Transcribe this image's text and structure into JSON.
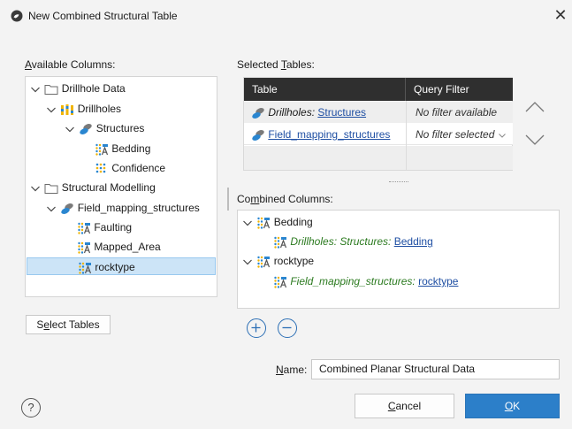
{
  "window": {
    "title": "New Combined Structural Table"
  },
  "available": {
    "label_u": "A",
    "label_rest": "vailable Columns:",
    "tree": [
      {
        "label": "Drillhole Data"
      },
      {
        "label": "Drillholes"
      },
      {
        "label": "Structures"
      },
      {
        "label": "Bedding"
      },
      {
        "label": "Confidence"
      },
      {
        "label": "Structural Modelling"
      },
      {
        "label": "Field_mapping_structures"
      },
      {
        "label": "Faulting"
      },
      {
        "label": "Mapped_Area"
      },
      {
        "label": "rocktype"
      }
    ],
    "select_tables_u": "e",
    "select_tables_pre": "S",
    "select_tables_post": "lect Tables"
  },
  "selected": {
    "label_pre": "Selected ",
    "label_u": "T",
    "label_post": "ables:",
    "headers": [
      "Table",
      "Query Filter"
    ],
    "rows": [
      {
        "table_pre": "Drillholes: ",
        "table_link": "Structures",
        "filter": "No filter available"
      },
      {
        "table_pre": "",
        "table_link": "Field_mapping_structures",
        "filter": "No filter selected"
      }
    ]
  },
  "combined": {
    "label_pre": "Co",
    "label_u": "m",
    "label_post": "bined Columns:",
    "items": [
      {
        "label": "Bedding",
        "source_pre": "Drillholes: Structures: ",
        "source_link": "Bedding"
      },
      {
        "label": "rocktype",
        "source_pre": "Field_mapping_structures: ",
        "source_link": "rocktype"
      }
    ]
  },
  "name": {
    "label_u": "N",
    "label_post": "ame:",
    "value": "Combined Planar Structural Data"
  },
  "footer": {
    "help": "?",
    "cancel_u": "C",
    "cancel_post": "ancel",
    "ok_u": "O",
    "ok_post": "K"
  },
  "colors": {
    "accent": "#2c7fc9",
    "header_bg": "#2f2f2f",
    "selection": "#cce4f7",
    "green_text": "#2b7a1f",
    "link": "#1f4fa3"
  },
  "icons": [
    "leapfrog-app-icon",
    "close-icon",
    "chevron-down-icon",
    "folder-icon",
    "drillholes-icon",
    "structures-icon",
    "planar-column-icon",
    "arrow-up-icon",
    "arrow-down-icon",
    "add-circle-icon",
    "remove-circle-icon",
    "help-icon"
  ]
}
